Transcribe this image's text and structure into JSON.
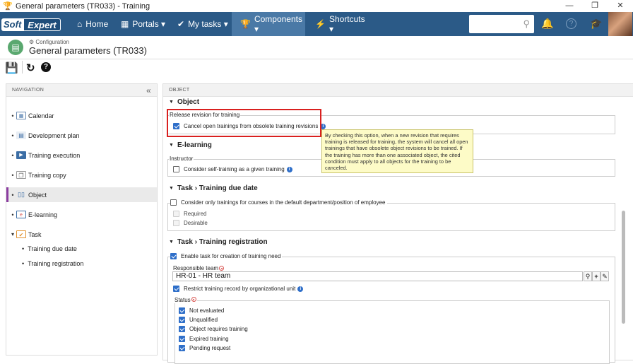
{
  "window": {
    "title": "General parameters (TR033) - Training",
    "minimize": "—",
    "restore": "❐",
    "close": "✕"
  },
  "navbar": {
    "logo_soft": "Soft",
    "logo_expert": "Expert",
    "items": [
      {
        "label": "Home",
        "icon": "home-icon",
        "glyph": "⌂"
      },
      {
        "label": "Portals ▾",
        "icon": "portals-icon",
        "glyph": "▦"
      },
      {
        "label": "My tasks ▾",
        "icon": "check-icon",
        "glyph": "✔"
      },
      {
        "label": "Components ▾",
        "icon": "trophy-icon",
        "glyph": "🏆"
      },
      {
        "label": "Shortcuts ▾",
        "icon": "lightning-icon",
        "glyph": "⚡"
      }
    ],
    "search_placeholder": "",
    "icons": {
      "bell": "🔔",
      "help": "?",
      "cap": "🎓",
      "search": "⚲"
    }
  },
  "header": {
    "breadcrumb": "Configuration",
    "breadcrumb_icon": "⚙",
    "title": "General parameters (TR033)"
  },
  "toolbar": {
    "save_icon": "💾",
    "refresh_icon": "↻",
    "help_icon": "?"
  },
  "navigation": {
    "title": "NAVIGATION",
    "collapse": "«",
    "items": [
      {
        "label": "Calendar"
      },
      {
        "label": "Development plan"
      },
      {
        "label": "Training execution"
      },
      {
        "label": "Training copy"
      },
      {
        "label": "Object"
      },
      {
        "label": "E-learning"
      },
      {
        "label": "Task"
      }
    ],
    "subitems": [
      "Training due date",
      "Training registration"
    ]
  },
  "content": {
    "panel_title": "OBJECT",
    "object": {
      "title": "Object",
      "legend": "Release revision for training",
      "option": "Cancel open trainings from obsolete training revisions"
    },
    "tooltip": "By checking this option, when a new revision that requires training is released for training, the system will cancel all open trainings that have obsolete object revisions to be trained. If the training has more than one associated object, the cited condition must apply to all objects for the training to be canceled.",
    "elearning": {
      "title": "E-learning",
      "legend": "Instructor",
      "option": "Consider self-training as a given training"
    },
    "due_date": {
      "title": "Task › Training due date",
      "legend": "Consider only trainings for courses in the default department/position of employee",
      "options": [
        "Required",
        "Desirable"
      ]
    },
    "registration": {
      "title": "Task › Training registration",
      "legend": "Enable task for creation of training need",
      "team_label": "Responsible team",
      "team_value": "HR-01 - HR team",
      "restrict": "Restrict training record by organizational unit",
      "status_label": "Status",
      "statuses": [
        "Not evaluated",
        "Unqualified",
        "Object requires training",
        "Expired training",
        "Pending request"
      ]
    }
  }
}
